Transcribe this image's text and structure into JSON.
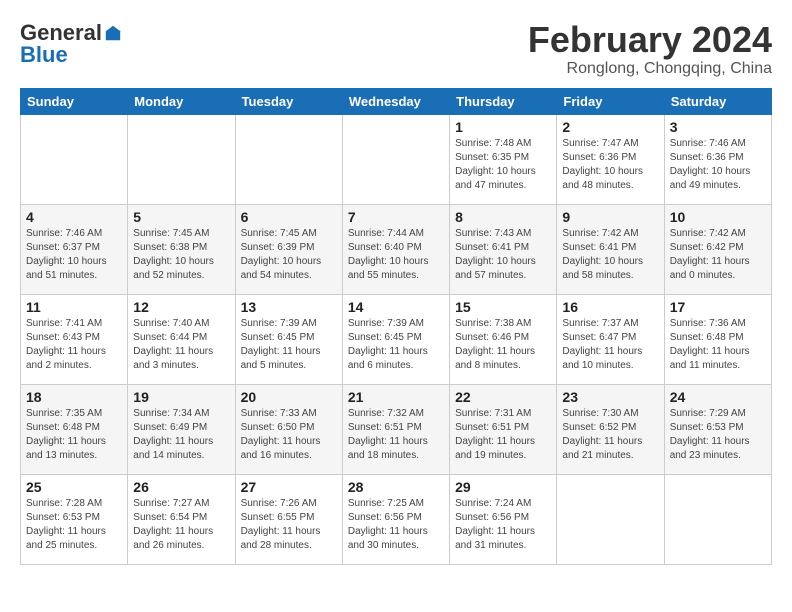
{
  "logo": {
    "general": "General",
    "blue": "Blue"
  },
  "title": "February 2024",
  "subtitle": "Ronglong, Chongqing, China",
  "days_of_week": [
    "Sunday",
    "Monday",
    "Tuesday",
    "Wednesday",
    "Thursday",
    "Friday",
    "Saturday"
  ],
  "weeks": [
    [
      {
        "day": "",
        "empty": true
      },
      {
        "day": "",
        "empty": true
      },
      {
        "day": "",
        "empty": true
      },
      {
        "day": "",
        "empty": true
      },
      {
        "day": "1",
        "sunrise": "7:48 AM",
        "sunset": "6:35 PM",
        "daylight": "10 hours and 47 minutes."
      },
      {
        "day": "2",
        "sunrise": "7:47 AM",
        "sunset": "6:36 PM",
        "daylight": "10 hours and 48 minutes."
      },
      {
        "day": "3",
        "sunrise": "7:46 AM",
        "sunset": "6:36 PM",
        "daylight": "10 hours and 49 minutes."
      }
    ],
    [
      {
        "day": "4",
        "sunrise": "7:46 AM",
        "sunset": "6:37 PM",
        "daylight": "10 hours and 51 minutes."
      },
      {
        "day": "5",
        "sunrise": "7:45 AM",
        "sunset": "6:38 PM",
        "daylight": "10 hours and 52 minutes."
      },
      {
        "day": "6",
        "sunrise": "7:45 AM",
        "sunset": "6:39 PM",
        "daylight": "10 hours and 54 minutes."
      },
      {
        "day": "7",
        "sunrise": "7:44 AM",
        "sunset": "6:40 PM",
        "daylight": "10 hours and 55 minutes."
      },
      {
        "day": "8",
        "sunrise": "7:43 AM",
        "sunset": "6:41 PM",
        "daylight": "10 hours and 57 minutes."
      },
      {
        "day": "9",
        "sunrise": "7:42 AM",
        "sunset": "6:41 PM",
        "daylight": "10 hours and 58 minutes."
      },
      {
        "day": "10",
        "sunrise": "7:42 AM",
        "sunset": "6:42 PM",
        "daylight": "11 hours and 0 minutes."
      }
    ],
    [
      {
        "day": "11",
        "sunrise": "7:41 AM",
        "sunset": "6:43 PM",
        "daylight": "11 hours and 2 minutes."
      },
      {
        "day": "12",
        "sunrise": "7:40 AM",
        "sunset": "6:44 PM",
        "daylight": "11 hours and 3 minutes."
      },
      {
        "day": "13",
        "sunrise": "7:39 AM",
        "sunset": "6:45 PM",
        "daylight": "11 hours and 5 minutes."
      },
      {
        "day": "14",
        "sunrise": "7:39 AM",
        "sunset": "6:45 PM",
        "daylight": "11 hours and 6 minutes."
      },
      {
        "day": "15",
        "sunrise": "7:38 AM",
        "sunset": "6:46 PM",
        "daylight": "11 hours and 8 minutes."
      },
      {
        "day": "16",
        "sunrise": "7:37 AM",
        "sunset": "6:47 PM",
        "daylight": "11 hours and 10 minutes."
      },
      {
        "day": "17",
        "sunrise": "7:36 AM",
        "sunset": "6:48 PM",
        "daylight": "11 hours and 11 minutes."
      }
    ],
    [
      {
        "day": "18",
        "sunrise": "7:35 AM",
        "sunset": "6:48 PM",
        "daylight": "11 hours and 13 minutes."
      },
      {
        "day": "19",
        "sunrise": "7:34 AM",
        "sunset": "6:49 PM",
        "daylight": "11 hours and 14 minutes."
      },
      {
        "day": "20",
        "sunrise": "7:33 AM",
        "sunset": "6:50 PM",
        "daylight": "11 hours and 16 minutes."
      },
      {
        "day": "21",
        "sunrise": "7:32 AM",
        "sunset": "6:51 PM",
        "daylight": "11 hours and 18 minutes."
      },
      {
        "day": "22",
        "sunrise": "7:31 AM",
        "sunset": "6:51 PM",
        "daylight": "11 hours and 19 minutes."
      },
      {
        "day": "23",
        "sunrise": "7:30 AM",
        "sunset": "6:52 PM",
        "daylight": "11 hours and 21 minutes."
      },
      {
        "day": "24",
        "sunrise": "7:29 AM",
        "sunset": "6:53 PM",
        "daylight": "11 hours and 23 minutes."
      }
    ],
    [
      {
        "day": "25",
        "sunrise": "7:28 AM",
        "sunset": "6:53 PM",
        "daylight": "11 hours and 25 minutes."
      },
      {
        "day": "26",
        "sunrise": "7:27 AM",
        "sunset": "6:54 PM",
        "daylight": "11 hours and 26 minutes."
      },
      {
        "day": "27",
        "sunrise": "7:26 AM",
        "sunset": "6:55 PM",
        "daylight": "11 hours and 28 minutes."
      },
      {
        "day": "28",
        "sunrise": "7:25 AM",
        "sunset": "6:56 PM",
        "daylight": "11 hours and 30 minutes."
      },
      {
        "day": "29",
        "sunrise": "7:24 AM",
        "sunset": "6:56 PM",
        "daylight": "11 hours and 31 minutes."
      },
      {
        "day": "",
        "empty": true
      },
      {
        "day": "",
        "empty": true
      }
    ]
  ]
}
